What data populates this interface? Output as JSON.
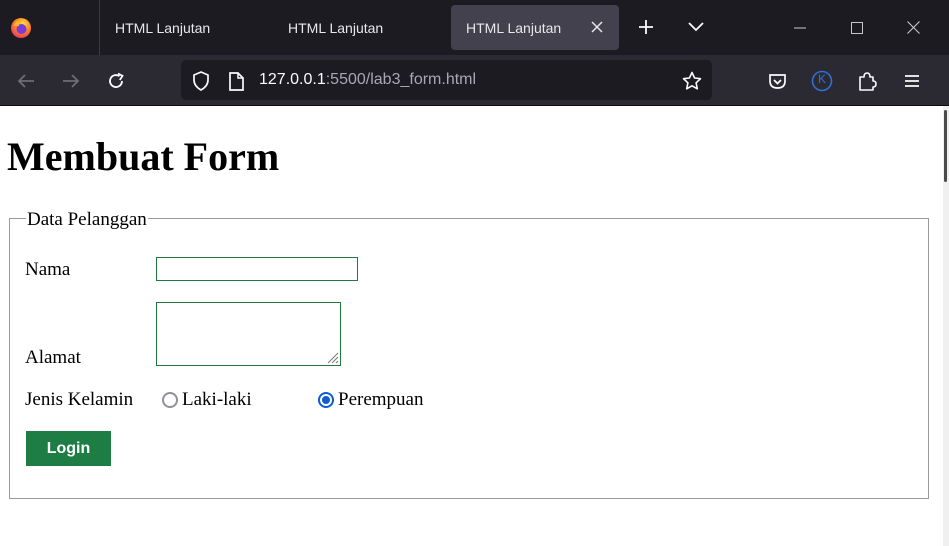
{
  "browser": {
    "tabs": [
      {
        "label": "HTML Lanjutan",
        "active": false
      },
      {
        "label": "HTML Lanjutan",
        "active": false
      },
      {
        "label": "HTML Lanjutan",
        "active": true
      }
    ],
    "url": {
      "host": "127.0.0.1",
      "rest": ":5500/lab3_form.html"
    },
    "profile_initial": "K",
    "colors": {
      "tabbar": "#1c1b22",
      "navbar": "#2b2a33",
      "active_tab": "#42414d",
      "profile": "#2f6fd6"
    }
  },
  "page": {
    "heading": "Membuat Form",
    "form": {
      "legend": "Data Pelanggan",
      "nama_label": "Nama",
      "nama_value": "",
      "alamat_label": "Alamat",
      "alamat_value": "",
      "gender_label": "Jenis Kelamin",
      "gender_options": [
        {
          "label": "Laki-laki",
          "checked": false
        },
        {
          "label": "Perempuan",
          "checked": true
        }
      ],
      "submit_label": "Login"
    },
    "colors": {
      "button": "#1e7d45",
      "input_border": "#1f7a3e",
      "radio_checked": "#0b5cd5"
    }
  }
}
